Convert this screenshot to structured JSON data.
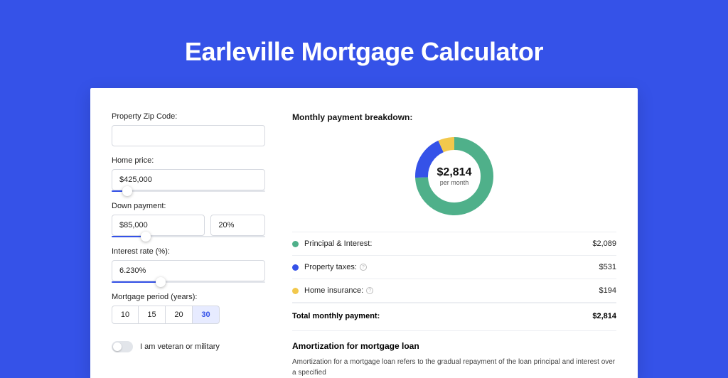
{
  "title": "Earleville Mortgage Calculator",
  "form": {
    "zip": {
      "label": "Property Zip Code:",
      "value": ""
    },
    "homePrice": {
      "label": "Home price:",
      "value": "$425,000",
      "sliderPercent": 10
    },
    "downPayment": {
      "label": "Down payment:",
      "value": "$85,000",
      "percent": "20%",
      "sliderPercent": 22
    },
    "interest": {
      "label": "Interest rate (%):",
      "value": "6.230%",
      "sliderPercent": 32
    },
    "period": {
      "label": "Mortgage period (years):",
      "options": [
        "10",
        "15",
        "20",
        "30"
      ],
      "selected": "30"
    },
    "veteran": {
      "label": "I am veteran or military",
      "checked": false
    }
  },
  "breakdown": {
    "title": "Monthly payment breakdown:",
    "centerAmount": "$2,814",
    "centerSub": "per month",
    "items": [
      {
        "label": "Principal & Interest:",
        "value": "$2,089",
        "color": "#4fb08a",
        "info": false
      },
      {
        "label": "Property taxes:",
        "value": "$531",
        "color": "#3552e8",
        "info": true
      },
      {
        "label": "Home insurance:",
        "value": "$194",
        "color": "#f2c84c",
        "info": true
      }
    ],
    "total": {
      "label": "Total monthly payment:",
      "value": "$2,814"
    }
  },
  "amort": {
    "title": "Amortization for mortgage loan",
    "text": "Amortization for a mortgage loan refers to the gradual repayment of the loan principal and interest over a specified"
  },
  "chart_data": {
    "type": "pie",
    "title": "Monthly payment breakdown",
    "series": [
      {
        "name": "Principal & Interest",
        "value": 2089,
        "color": "#4fb08a"
      },
      {
        "name": "Property taxes",
        "value": 531,
        "color": "#3552e8"
      },
      {
        "name": "Home insurance",
        "value": 194,
        "color": "#f2c84c"
      }
    ],
    "total": 2814
  }
}
